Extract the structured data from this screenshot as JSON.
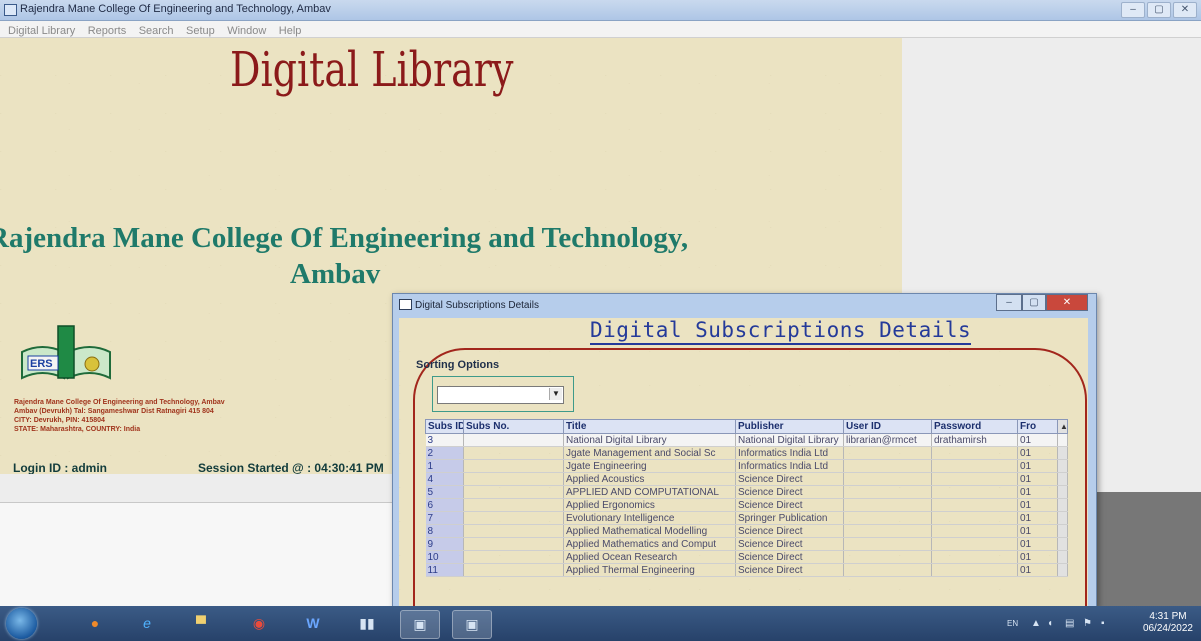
{
  "app": {
    "title": "Rajendra Mane College Of  Engineering and Technology, Ambav",
    "controls": [
      "–",
      "▢",
      "✕"
    ],
    "menu": [
      "Digital Library",
      "Reports",
      "Search",
      "Setup",
      "Window",
      "Help"
    ]
  },
  "main": {
    "heading": "Digital Library",
    "college_line1": "Rajendra Mane College Of  Engineering and Technology,",
    "college_line2": "Ambav",
    "address": [
      "Rajendra Mane College Of Engineering and Technology, Ambav",
      "Ambav (Devrukh) Tal: Sangameshwar Dist Ratnagiri 415 804",
      "CITY: Devrukh, PIN: 415804",
      "STATE: Maharashtra, COUNTRY: India"
    ],
    "logo_text": "ERS",
    "login": "Login ID : admin",
    "session": "Session Started @ : 04:30:41 PM"
  },
  "dialog": {
    "title": "Digital Subscriptions Details",
    "heading": "Digital Subscriptions Details",
    "sorting_label": "Sorting Options",
    "sort_arrow": "▼",
    "controls": [
      "–",
      "▢",
      "✕"
    ],
    "scroll_up": "▲",
    "columns": [
      "Subs ID",
      "Subs No.",
      "Title",
      "Publisher",
      "User ID",
      "Password",
      "Fro"
    ],
    "rows": [
      {
        "id": "3",
        "title": "National Digital Library",
        "publisher": "National Digital Library",
        "user": "librarian@rmcet",
        "password": "drathamirsh",
        "from": "01"
      },
      {
        "id": "2",
        "title": "Jgate Management and Social Sc",
        "publisher": "Informatics India Ltd",
        "user": "",
        "password": "",
        "from": "01"
      },
      {
        "id": "1",
        "title": "Jgate Engineering",
        "publisher": "Informatics India Ltd",
        "user": "",
        "password": "",
        "from": "01"
      },
      {
        "id": "4",
        "title": "Applied Acoustics",
        "publisher": "Science Direct",
        "user": "",
        "password": "",
        "from": "01"
      },
      {
        "id": "5",
        "title": "APPLIED AND COMPUTATIONAL",
        "publisher": "Science Direct",
        "user": "",
        "password": "",
        "from": "01"
      },
      {
        "id": "6",
        "title": "Applied Ergonomics",
        "publisher": "Science Direct",
        "user": "",
        "password": "",
        "from": "01"
      },
      {
        "id": "7",
        "title": "Evolutionary Intelligence",
        "publisher": "Springer Publication",
        "user": "",
        "password": "",
        "from": "01"
      },
      {
        "id": "8",
        "title": "Applied Mathematical Modelling",
        "publisher": "Science Direct",
        "user": "",
        "password": "",
        "from": "01"
      },
      {
        "id": "9",
        "title": "Applied Mathematics and Comput",
        "publisher": "Science Direct",
        "user": "",
        "password": "",
        "from": "01"
      },
      {
        "id": "10",
        "title": "Applied Ocean Research",
        "publisher": "Science Direct",
        "user": "",
        "password": "",
        "from": "01"
      },
      {
        "id": "11",
        "title": "Applied Thermal Engineering",
        "publisher": "Science Direct",
        "user": "",
        "password": "",
        "from": "01"
      }
    ]
  },
  "taskbar": {
    "lang": "EN",
    "time": "4:31 PM",
    "date": "06/24/2022"
  }
}
